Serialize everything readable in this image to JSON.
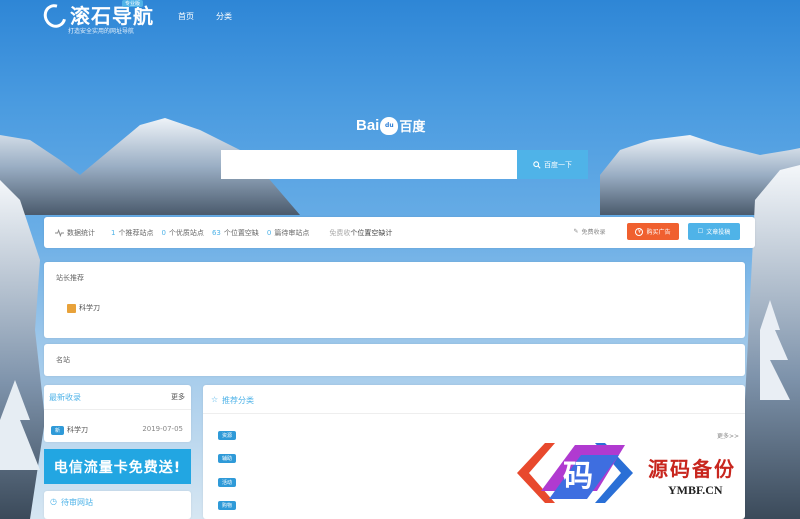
{
  "brand": {
    "name": "滚石导航",
    "badge": "专业版",
    "slogan": "打造安全实用的网址导航"
  },
  "nav": [
    {
      "label": "首页"
    },
    {
      "label": "分类"
    }
  ],
  "search": {
    "logo_bai": "Bai",
    "logo_paw": "du",
    "logo_cn": "百度",
    "button": "百度一下",
    "placeholder": ""
  },
  "stats": {
    "title": "数据统计",
    "recommend_count": "1",
    "recommend_label": "个推荐站点",
    "quality_count": "0",
    "quality_label": "个优质站点",
    "vacant_count": "63",
    "vacant_label": "个位置空缺",
    "pending_count": "0",
    "pending_label": "篇待审站点",
    "ghost_text": "免费收",
    "overlay_text": "个位置空缺计",
    "free_collect": "免费收录",
    "buy_ad": "购买广告",
    "submit_article": "文章投稿"
  },
  "admin_recommend": {
    "title": "站长推荐",
    "items": [
      {
        "label": "科学刀"
      }
    ]
  },
  "famous": {
    "title": "名站"
  },
  "latest": {
    "title": "最新收录",
    "more": "更多",
    "items": [
      {
        "badge": "新",
        "label": "科学刀",
        "date": "2019-07-05"
      }
    ]
  },
  "recommend_category": {
    "title": "推荐分类",
    "more": "更多>>",
    "tags": [
      "资源",
      "辅助",
      "活动",
      "购物"
    ]
  },
  "promo": {
    "text": "电信流量卡免费送!"
  },
  "pending": {
    "title": "待审网站"
  },
  "watermark": {
    "glyph": "码",
    "cn": "源码备份",
    "en": "YMBF.CN"
  },
  "colors": {
    "accent": "#4fb3e8",
    "buy_ad": "#f0602f",
    "submit": "#4fb3e8",
    "tag": "#2f9ad8",
    "watermark_red": "#c8261e"
  }
}
